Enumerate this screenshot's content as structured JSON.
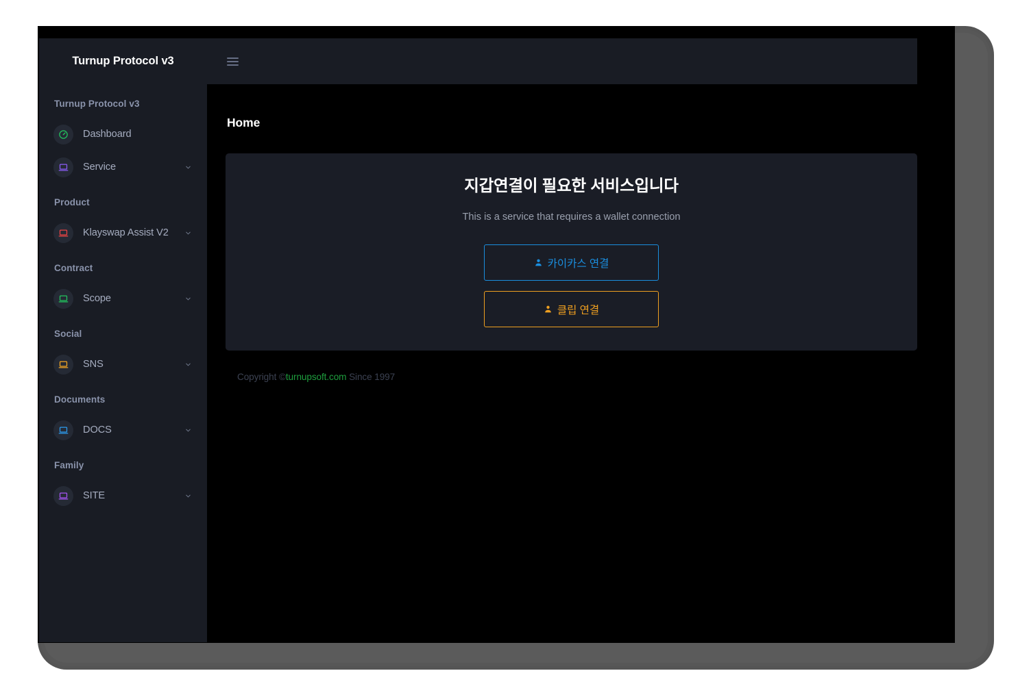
{
  "brand": {
    "title": "Turnup Protocol v3"
  },
  "topbar": {
    "menu_icon": "hamburger-icon"
  },
  "sidebar": {
    "sections": [
      {
        "title": "Turnup Protocol v3",
        "items": [
          {
            "label": "Dashboard",
            "icon": "speedometer-icon",
            "icon_color": "#22c55e",
            "has_chevron": false
          },
          {
            "label": "Service",
            "icon": "laptop-icon",
            "icon_color": "#8b5cf6",
            "has_chevron": true
          }
        ]
      },
      {
        "title": "Product",
        "items": [
          {
            "label": "Klayswap Assist V2",
            "icon": "laptop-icon",
            "icon_color": "#ef4444",
            "has_chevron": true
          }
        ]
      },
      {
        "title": "Contract",
        "items": [
          {
            "label": "Scope",
            "icon": "laptop-icon",
            "icon_color": "#22c55e",
            "has_chevron": true
          }
        ]
      },
      {
        "title": "Social",
        "items": [
          {
            "label": "SNS",
            "icon": "laptop-icon",
            "icon_color": "#f5a623",
            "has_chevron": true
          }
        ]
      },
      {
        "title": "Documents",
        "items": [
          {
            "label": "DOCS",
            "icon": "laptop-icon",
            "icon_color": "#2d9cf0",
            "has_chevron": true
          }
        ]
      },
      {
        "title": "Family",
        "items": [
          {
            "label": "SITE",
            "icon": "laptop-icon",
            "icon_color": "#a855f7",
            "has_chevron": true
          }
        ]
      }
    ]
  },
  "page": {
    "title": "Home"
  },
  "wallet_card": {
    "title": "지갑연결이 필요한 서비스입니다",
    "subtitle": "This is a service that requires a wallet connection",
    "buttons": [
      {
        "label": "카이카스 연결",
        "icon": "user-icon",
        "color": "#1a8fe0"
      },
      {
        "label": "클립 연결",
        "icon": "user-icon",
        "color": "#f0a020"
      }
    ]
  },
  "footer": {
    "prefix": "Copyright ©",
    "link": "turnupsoft.com",
    "suffix": " Since 1997"
  },
  "colors": {
    "sidebar_bg": "#191c24",
    "card_bg": "#1a1d26",
    "content_bg": "#000000",
    "bezel": "#555555",
    "accent_blue": "#1a8fe0",
    "accent_orange": "#f0a020",
    "accent_green": "#1e9e3e"
  }
}
